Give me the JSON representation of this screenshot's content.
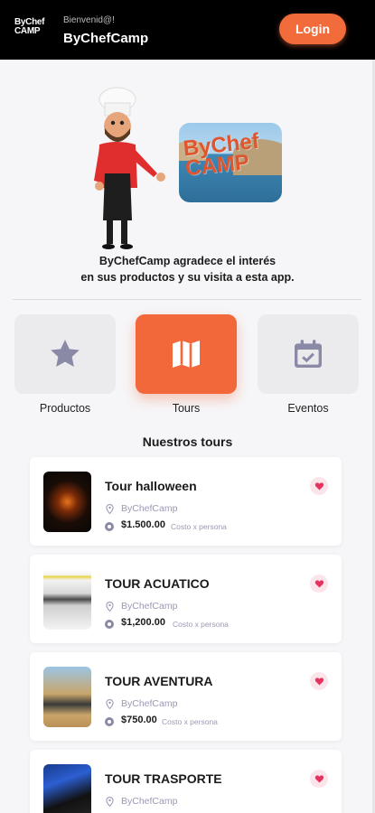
{
  "header": {
    "logo_line1": "ByChef",
    "logo_line2": "CAMP",
    "welcome": "Bienvenid@!",
    "brand": "ByChefCamp",
    "login_label": "Login"
  },
  "hero": {
    "promo_text_line1": "ByChef",
    "promo_text_line2": "CAMP",
    "thanks_line1": "ByChefCamp agradece el interés",
    "thanks_line2": "en sus productos y su visita a esta app."
  },
  "categories": [
    {
      "label": "Productos",
      "icon": "star-icon",
      "active": false
    },
    {
      "label": "Tours",
      "icon": "map-icon",
      "active": true
    },
    {
      "label": "Eventos",
      "icon": "calendar-check-icon",
      "active": false
    }
  ],
  "section_title": "Nuestros tours",
  "tours": [
    {
      "title": "Tour halloween",
      "org": "ByChefCamp",
      "price": "$1.500.00",
      "note": "Costo x persona"
    },
    {
      "title": "TOUR ACUATICO",
      "org": "ByChefCamp",
      "price": "$1,200.00",
      "note": "Costo x persona"
    },
    {
      "title": "TOUR AVENTURA",
      "org": "ByChefCamp",
      "price": "$750.00",
      "note": "Costo x persona"
    },
    {
      "title": "TOUR TRASPORTE",
      "org": "ByChefCamp",
      "price": "",
      "note": ""
    }
  ],
  "colors": {
    "accent": "#f26b3a",
    "header_bg": "#000000",
    "icon_gray": "#8a8aa6",
    "heart": "#e8335f"
  }
}
